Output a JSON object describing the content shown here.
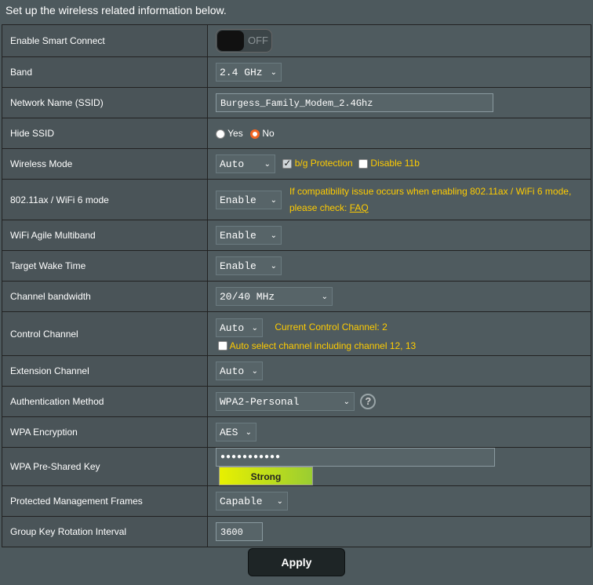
{
  "intro": "Set up the wireless related information below.",
  "rows": {
    "smart_connect": {
      "label": "Enable Smart Connect",
      "toggle": "OFF"
    },
    "band": {
      "label": "Band",
      "value": "2.4 GHz"
    },
    "ssid": {
      "label": "Network Name (SSID)",
      "value": "Burgess_Family_Modem_2.4Ghz"
    },
    "hide_ssid": {
      "label": "Hide SSID",
      "yes": "Yes",
      "no": "No",
      "selected": "No"
    },
    "wireless_mode": {
      "label": "Wireless Mode",
      "value": "Auto",
      "bg_protection": "b/g Protection",
      "bg_protection_checked": true,
      "disable_11b": "Disable 11b",
      "disable_11b_checked": false
    },
    "ax_mode": {
      "label": "802.11ax / WiFi 6 mode",
      "value": "Enable",
      "note_line1": "If compatibility issue occurs when enabling 802.11ax / WiFi 6 mode,",
      "note_line2": "please check:",
      "faq": "FAQ"
    },
    "agile_multiband": {
      "label": "WiFi Agile Multiband",
      "value": "Enable"
    },
    "target_wake": {
      "label": "Target Wake Time",
      "value": "Enable"
    },
    "channel_bw": {
      "label": "Channel bandwidth",
      "value": "20/40 MHz"
    },
    "control_channel": {
      "label": "Control Channel",
      "value": "Auto",
      "current": "Current Control Channel: 2",
      "auto_select": "Auto select channel including channel 12, 13",
      "auto_select_checked": false
    },
    "extension_channel": {
      "label": "Extension Channel",
      "value": "Auto"
    },
    "auth_method": {
      "label": "Authentication Method",
      "value": "WPA2-Personal",
      "help": "?"
    },
    "wpa_encryption": {
      "label": "WPA Encryption",
      "value": "AES"
    },
    "psk": {
      "label": "WPA Pre-Shared Key",
      "value": "●●●●●●●●●●●",
      "strength": "Strong"
    },
    "pmf": {
      "label": "Protected Management Frames",
      "value": "Capable"
    },
    "gk_rotation": {
      "label": "Group Key Rotation Interval",
      "value": "3600"
    }
  },
  "apply_label": "Apply",
  "colors": {
    "accent": "#ffcc00",
    "radio_selected": "#f26522"
  },
  "caret": "⌄"
}
